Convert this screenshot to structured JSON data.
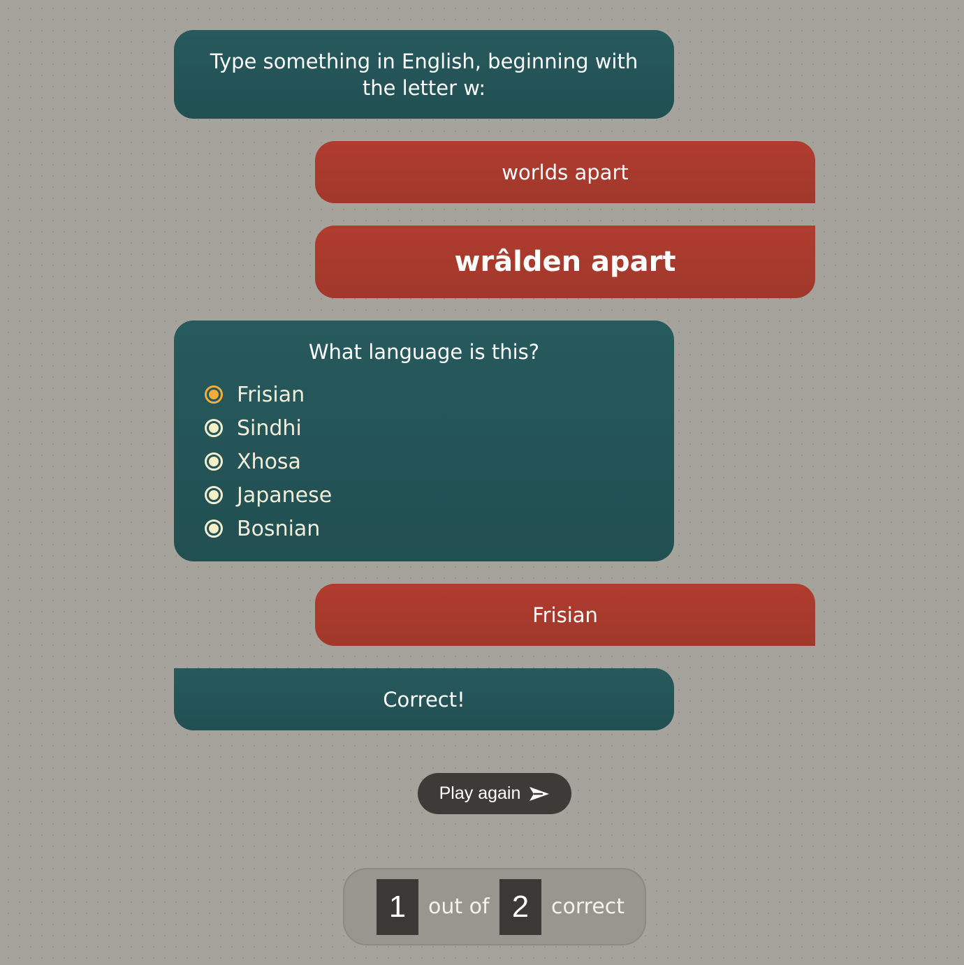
{
  "conversation": {
    "prompt": "Type something in English, beginning with the letter w:",
    "user_input": "worlds apart",
    "translation": "wrâlden apart",
    "question": {
      "title": "What language is this?",
      "options": [
        {
          "label": "Frisian",
          "selected": true
        },
        {
          "label": "Sindhi",
          "selected": false
        },
        {
          "label": "Xhosa",
          "selected": false
        },
        {
          "label": "Japanese",
          "selected": false
        },
        {
          "label": "Bosnian",
          "selected": false
        }
      ]
    },
    "answer": "Frisian",
    "result": "Correct!"
  },
  "play_again": {
    "label": "Play again",
    "icon": "paper-plane-icon"
  },
  "score": {
    "correct": "1",
    "middle_text": "out of",
    "total": "2",
    "suffix_text": "correct"
  },
  "colors": {
    "background": "#a6a39d",
    "bot_bubble": "#255558",
    "user_bubble": "#a93b2d",
    "selected_radio": "#f0ad3c",
    "radio": "#f6efc6",
    "button": "#3d3b38"
  }
}
